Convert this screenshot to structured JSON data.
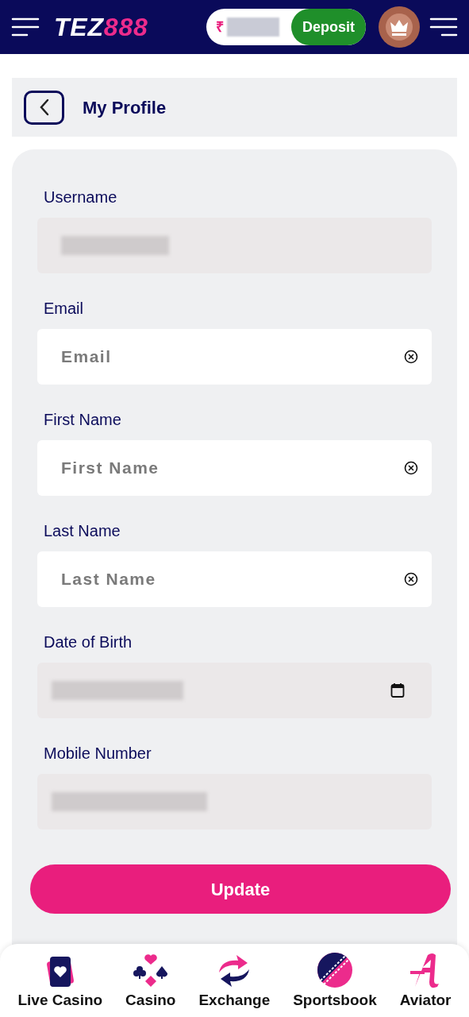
{
  "header": {
    "logo": {
      "part_1": "TEZ",
      "part_2": "888"
    },
    "currency": "₹",
    "deposit": "Deposit"
  },
  "page": {
    "title": "My Profile"
  },
  "fields": [
    {
      "label": "Username",
      "kind": "readonly"
    },
    {
      "label": "Email",
      "kind": "text",
      "placeholder": "Email"
    },
    {
      "label": "First Name",
      "kind": "text",
      "placeholder": "First Name"
    },
    {
      "label": "Last Name",
      "kind": "text",
      "placeholder": "Last Name"
    },
    {
      "label": "Date of Birth",
      "kind": "date"
    },
    {
      "label": "Mobile Number",
      "kind": "readonly"
    }
  ],
  "update": "Update",
  "nav": [
    {
      "label": "Live Casino",
      "kind": "cards"
    },
    {
      "label": "Casino",
      "kind": "suits"
    },
    {
      "label": "Exchange",
      "kind": "exchange"
    },
    {
      "label": "Sportsbook",
      "kind": "ball"
    },
    {
      "label": "Aviator",
      "kind": "aviator"
    }
  ]
}
